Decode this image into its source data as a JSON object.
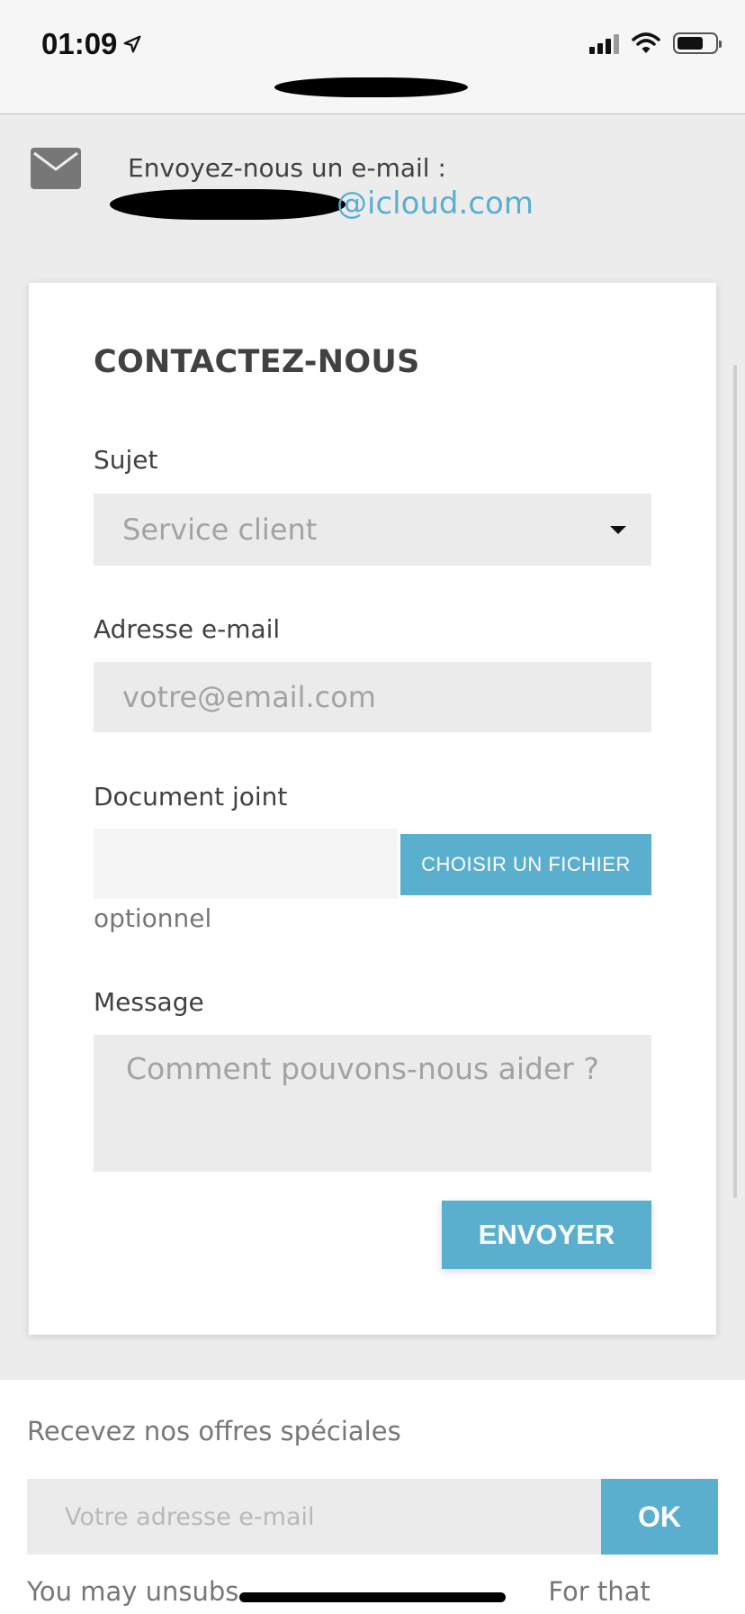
{
  "status_bar": {
    "time": "01:09",
    "icons": [
      "location-arrow-icon",
      "signal-icon",
      "wifi-icon",
      "battery-icon"
    ]
  },
  "contact_email": {
    "label": "Envoyez-nous un e-mail :",
    "address_visible_part": "@icloud.com",
    "icon": "mail-icon"
  },
  "form": {
    "title": "CONTACTEZ-NOUS",
    "subject": {
      "label": "Sujet",
      "selected": "Service client"
    },
    "email": {
      "label": "Adresse e-mail",
      "placeholder": "votre@email.com",
      "value": ""
    },
    "attachment": {
      "label": "Document joint",
      "button": "CHOISIR UN FICHIER",
      "hint": "optionnel"
    },
    "message": {
      "label": "Message",
      "placeholder": "Comment pouvons-nous aider ?",
      "value": ""
    },
    "submit": "ENVOYER"
  },
  "newsletter": {
    "title": "Recevez nos offres spéciales",
    "placeholder": "Votre adresse e-mail",
    "button": "OK",
    "footnote_start": "You may unsubs",
    "footnote_end": "For that"
  },
  "colors": {
    "accent": "#5aafcf",
    "field_bg": "#ebebeb",
    "page_bg": "#ececec",
    "text": "#414141"
  }
}
